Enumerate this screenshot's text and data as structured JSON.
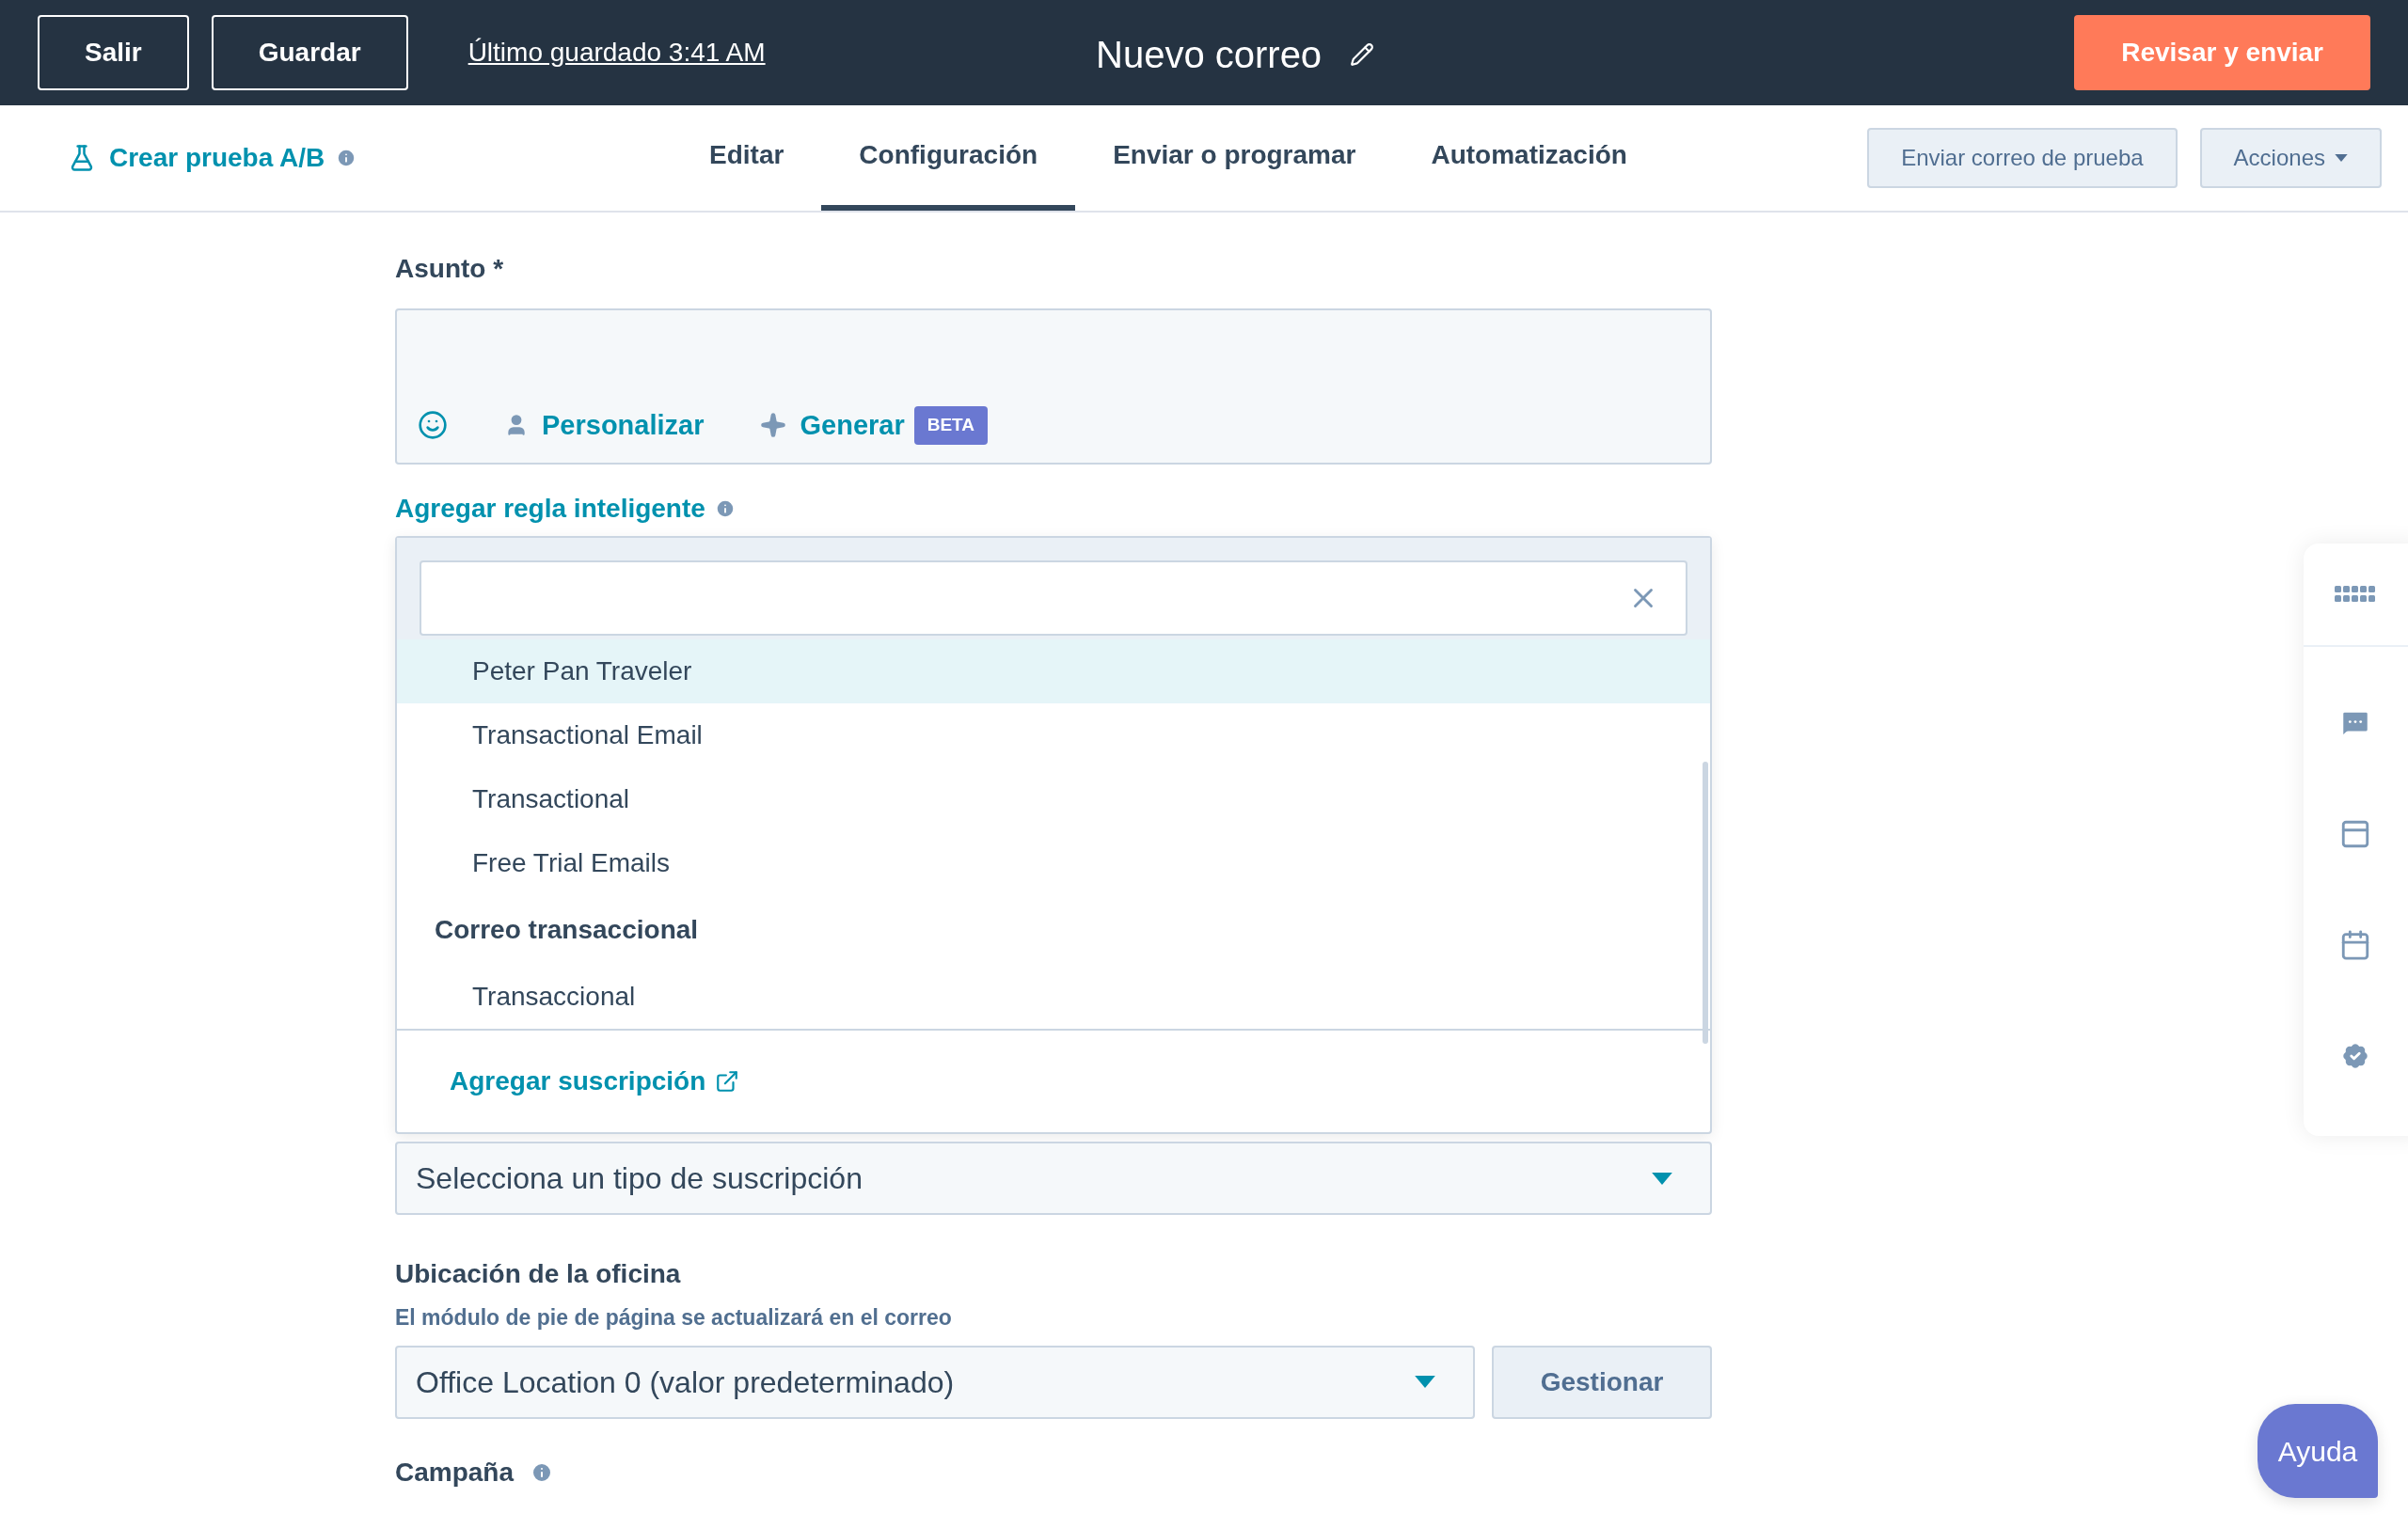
{
  "top_bar": {
    "buttons": [
      {
        "label": "Salir"
      },
      {
        "label": "Guardar"
      }
    ],
    "last_saved": "Último guardado 3:41 AM",
    "title": "Nuevo correo",
    "primary_button": "Revisar y enviar"
  },
  "toolbar": {
    "ab_test_link": "Crear prueba A/B",
    "tabs": [
      {
        "label": "Editar",
        "selected": false
      },
      {
        "label": "Configuración",
        "selected": true
      },
      {
        "label": "Enviar o programar",
        "selected": false
      },
      {
        "label": "Automatización",
        "selected": false
      }
    ],
    "test_email_button": "Enviar correo de prueba",
    "actions_button": "Acciones"
  },
  "subject": {
    "label": "Asunto *",
    "personalize": "Personalizar",
    "generate": "Generar",
    "badge": "BETA"
  },
  "smart_rule_link": "Agregar regla inteligente",
  "dropdown": {
    "items": [
      {
        "kind": "option",
        "label": "Peter Pan Traveler",
        "highlighted": true
      },
      {
        "kind": "option",
        "label": "Transactional Email",
        "highlighted": false
      },
      {
        "kind": "option",
        "label": "Transactional",
        "highlighted": false
      },
      {
        "kind": "option",
        "label": "Free Trial Emails",
        "highlighted": false
      },
      {
        "kind": "group",
        "label": "Correo transaccional"
      },
      {
        "kind": "option",
        "label": "Transaccional",
        "highlighted": false
      }
    ],
    "footer_link": "Agregar suscripción"
  },
  "subscription_select": {
    "placeholder": "Selecciona un tipo de suscripción"
  },
  "office": {
    "label": "Ubicación de la oficina",
    "hint": "El módulo de pie de página se actualizará en el correo",
    "value": "Office Location 0 (valor predeterminado)",
    "button": "Gestionar"
  },
  "campaign_label": "Campaña",
  "help_button": "Ayuda"
}
